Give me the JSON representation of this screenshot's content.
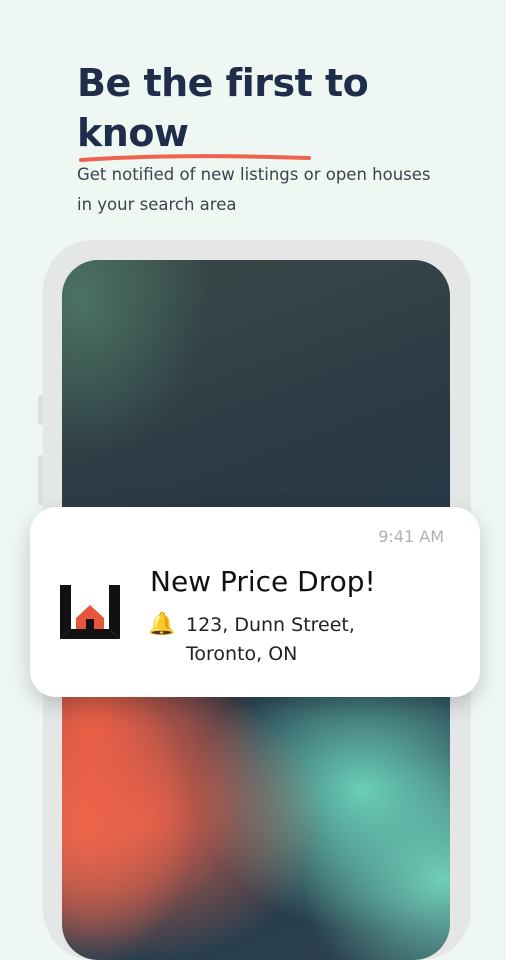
{
  "headline": {
    "line1": "Be the first to",
    "line2": "know"
  },
  "subtitle": "Get notified of new listings or open houses in your search area",
  "notification": {
    "time": "9:41 AM",
    "title": "New Price Drop!",
    "body_line1": "123, Dunn Street,",
    "body_line2": "Toronto, ON",
    "icon": "bell-icon"
  },
  "colors": {
    "background": "#eef7f1",
    "headline": "#1f2d4a",
    "accent_underline": "#f0624d",
    "logo_red": "#e8553f"
  }
}
